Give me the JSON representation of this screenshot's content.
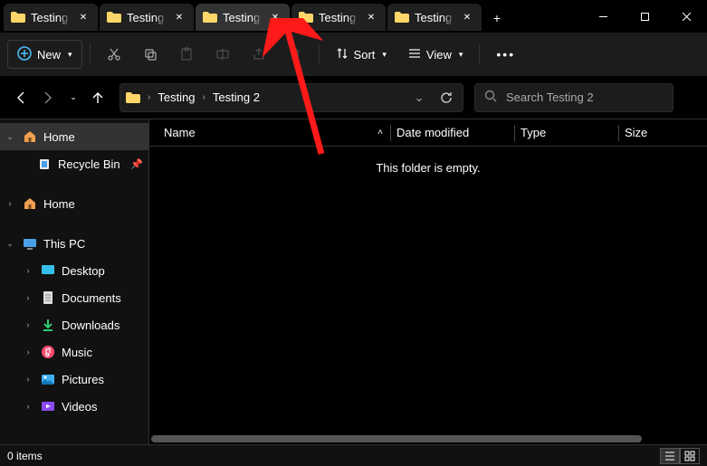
{
  "tabs": [
    {
      "label": "Testing"
    },
    {
      "label": "Testing"
    },
    {
      "label": "Testing"
    },
    {
      "label": "Testing"
    },
    {
      "label": "Testing"
    }
  ],
  "active_tab_index": 2,
  "toolbar": {
    "new_label": "New",
    "sort_label": "Sort",
    "view_label": "View"
  },
  "breadcrumbs": [
    "Testing",
    "Testing 2"
  ],
  "search": {
    "placeholder": "Search Testing 2"
  },
  "columns": {
    "name": "Name",
    "date": "Date modified",
    "type": "Type",
    "size": "Size"
  },
  "empty_message": "This folder is empty.",
  "sidebar": {
    "home": "Home",
    "recycle": "Recycle Bin",
    "home2": "Home",
    "thispc": "This PC",
    "desktop": "Desktop",
    "documents": "Documents",
    "downloads": "Downloads",
    "music": "Music",
    "pictures": "Pictures",
    "videos": "Videos"
  },
  "status": {
    "items": "0 items"
  }
}
